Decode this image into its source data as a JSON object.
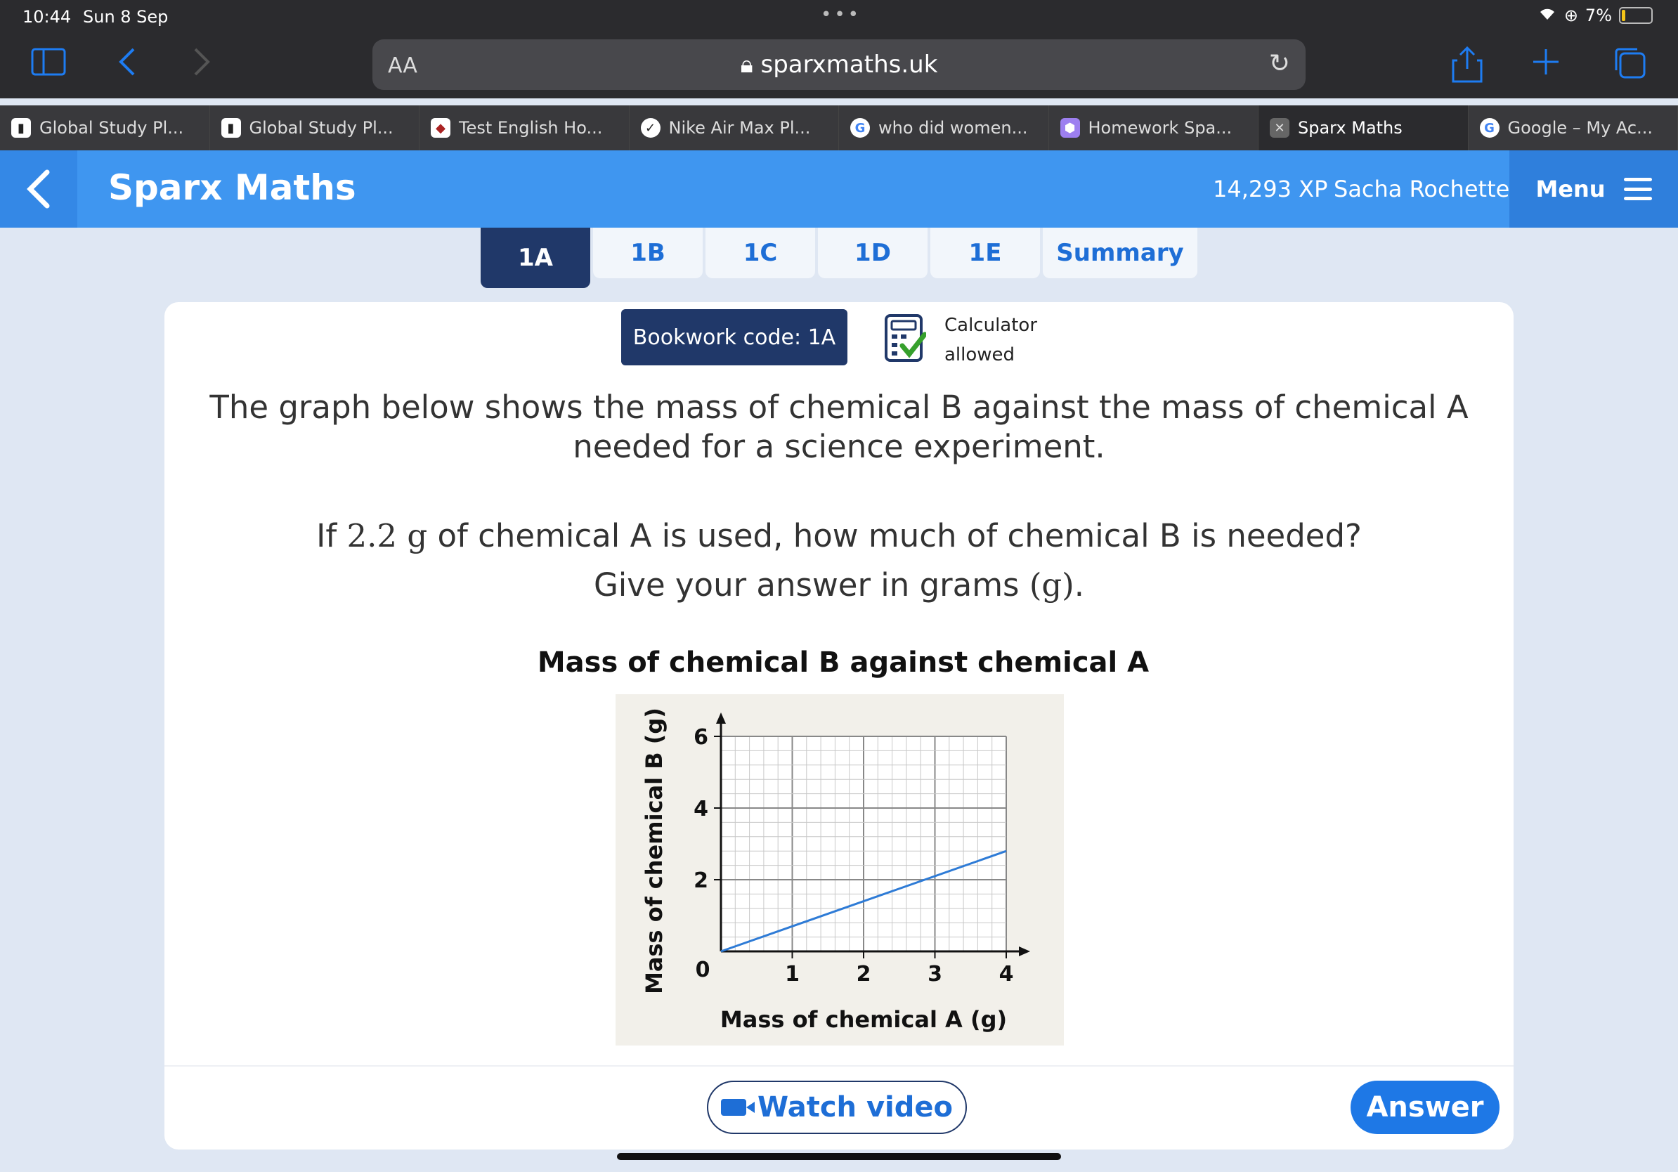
{
  "status_bar": {
    "time": "10:44",
    "date": "Sun 8 Sep",
    "battery": "7%"
  },
  "browser": {
    "aa_label": "AA",
    "url": "sparxmaths.uk",
    "tabs": [
      {
        "label": "Global Study Pl...",
        "icon": "app-icon",
        "active": false
      },
      {
        "label": "Global Study Pl...",
        "icon": "app-icon",
        "active": false
      },
      {
        "label": "Test English Ho...",
        "icon": "school-crest-icon",
        "active": false
      },
      {
        "label": "Nike Air Max Pl...",
        "icon": "nike-icon",
        "active": false
      },
      {
        "label": "who did women...",
        "icon": "google-icon",
        "active": false
      },
      {
        "label": "Homework Spa...",
        "icon": "homework-icon",
        "active": false
      },
      {
        "label": "Sparx Maths",
        "icon": "close-icon",
        "active": true
      },
      {
        "label": "Google – My Ac...",
        "icon": "google-icon",
        "active": false
      }
    ]
  },
  "header": {
    "brand": "Sparx Maths",
    "xp": "14,293 XP",
    "user": "Sacha Rochette",
    "menu_label": "Menu"
  },
  "task_tabs": [
    "1A",
    "1B",
    "1C",
    "1D",
    "1E",
    "Summary"
  ],
  "question": {
    "bookwork": "Bookwork code: 1A",
    "calculator_line1": "Calculator",
    "calculator_line2": "allowed",
    "line1": "The graph below shows the mass of chemical B against the mass of chemical A",
    "line2": "needed for a science experiment.",
    "q_pre": "If ",
    "q_math": "2.2 g",
    "q_post": " of chemical A is used, how much of chemical B is needed?",
    "g_pre": "Give your answer in grams ",
    "g_math": "(g)",
    "g_post": "."
  },
  "chart_data": {
    "type": "line",
    "title": "Mass of chemical B against chemical A",
    "xlabel": "Mass of chemical A (g)",
    "ylabel": "Mass of chemical B (g)",
    "xlim": [
      0,
      4
    ],
    "ylim": [
      0,
      6
    ],
    "x_ticks": [
      0,
      1,
      2,
      3,
      4
    ],
    "y_ticks": [
      2,
      4,
      6
    ],
    "origin_label": "0",
    "grid": true,
    "series": [
      {
        "x": [
          0,
          4
        ],
        "y": [
          0,
          2.8
        ],
        "color": "#2e7bd6"
      }
    ]
  },
  "buttons": {
    "watch_video": "Watch video",
    "answer": "Answer"
  },
  "colors": {
    "header": "#3f96f0",
    "navy": "#203869",
    "accent": "#1e78e6"
  }
}
